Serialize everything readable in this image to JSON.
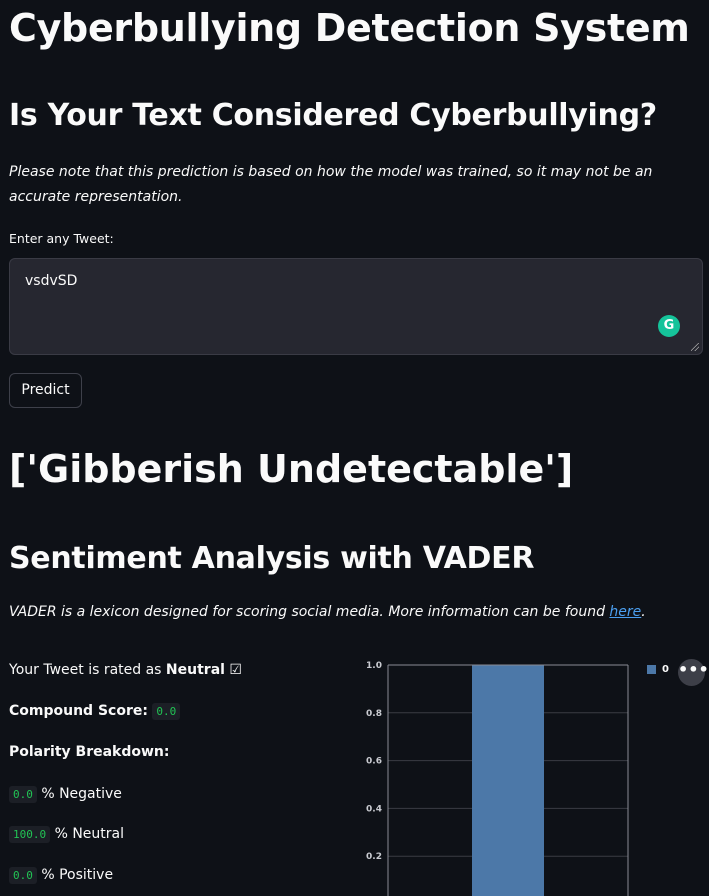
{
  "header": {
    "title": "Cyberbullying Detection System",
    "subtitle": "Is Your Text Considered Cyberbullying?",
    "note": "Please note that this prediction is based on how the model was trained, so it may not be an accurate representation."
  },
  "form": {
    "label": "Enter any Tweet:",
    "value": "vsdvSD",
    "grammarly_glyph": "G",
    "button": "Predict"
  },
  "result": {
    "text": "['Gibberish Undetectable']"
  },
  "sentiment": {
    "heading": "Sentiment Analysis with VADER",
    "desc_prefix": "VADER is a lexicon designed for scoring social media. More information can be found ",
    "link_text": "here",
    "desc_suffix": ".",
    "rated_prefix": "Your Tweet is rated as ",
    "rating": "Neutral",
    "rating_icon": "☑",
    "compound_label": "Compound Score:",
    "compound_value": "0.0",
    "polarity_label": "Polarity Breakdown:",
    "negative_value": "0.0",
    "negative_label": "% Negative",
    "neutral_value": "100.0",
    "neutral_label": "% Neutral",
    "positive_value": "0.0",
    "positive_label": "% Positive"
  },
  "chart_data": {
    "type": "bar",
    "categories": [
      ""
    ],
    "series": [
      {
        "name": "0",
        "values": [
          1.0
        ],
        "color": "#4c78a8"
      }
    ],
    "yticks": [
      "0.2",
      "0.4",
      "0.6",
      "0.8",
      "1.0"
    ],
    "ylim": [
      0,
      1.0
    ]
  },
  "menu": {
    "more_glyph": "•••"
  }
}
